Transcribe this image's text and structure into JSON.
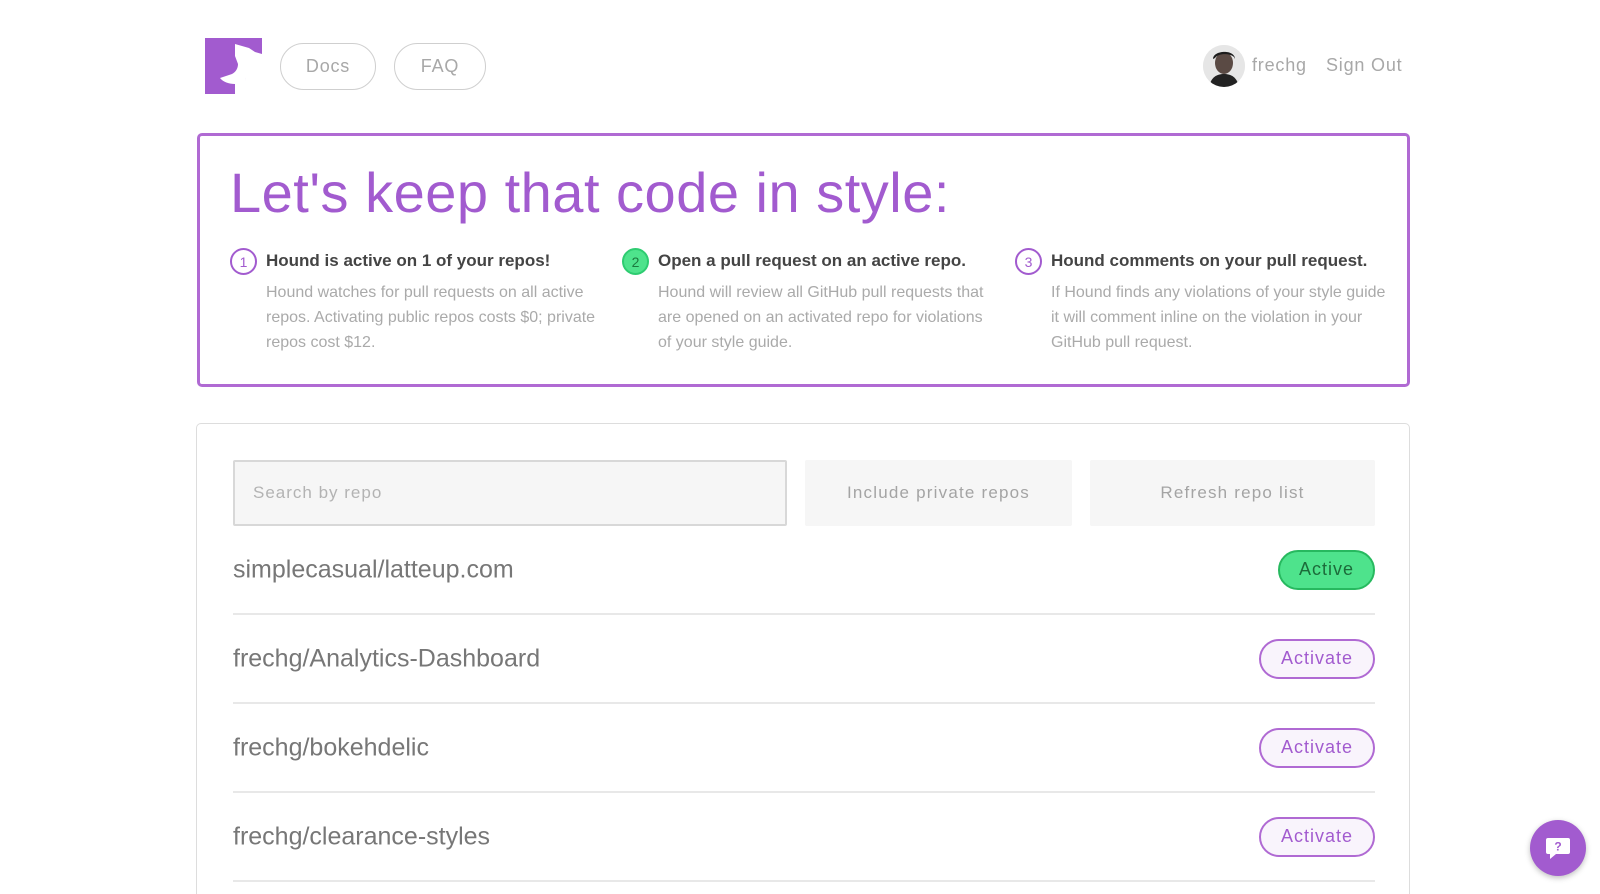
{
  "brand": {
    "accent": "#a25bcf",
    "success": "#4ee38c"
  },
  "header": {
    "logo_icon": "hound-dog-logo-icon",
    "nav": [
      {
        "label": "Docs"
      },
      {
        "label": "FAQ"
      }
    ],
    "user": {
      "name": "frechg",
      "avatar_icon": "user-avatar"
    },
    "signout_label": "Sign Out"
  },
  "hero": {
    "title": "Let's keep that code in style:",
    "steps": [
      {
        "number": "1",
        "title": "Hound is active on 1 of your repos!",
        "body": "Hound watches for pull requests on all active repos. Activating public repos costs $0; private repos cost $12."
      },
      {
        "number": "2",
        "title": "Open a pull request on an active repo.",
        "body": "Hound will review all GitHub pull requests that are opened on an activated repo for violations of your style guide."
      },
      {
        "number": "3",
        "title": "Hound comments on your pull request.",
        "body": "If Hound finds any violations of your style guide it will comment inline on the violation in your GitHub pull request."
      }
    ]
  },
  "repos": {
    "search": {
      "placeholder": "Search by repo",
      "value": ""
    },
    "private_button": "Include private repos",
    "refresh_button": "Refresh repo list",
    "items": [
      {
        "name": "simplecasual/latteup.com",
        "status": "Active"
      },
      {
        "name": "frechg/Analytics-Dashboard",
        "status": "Activate"
      },
      {
        "name": "frechg/bokehdelic",
        "status": "Activate"
      },
      {
        "name": "frechg/clearance-styles",
        "status": "Activate"
      }
    ]
  },
  "help": {
    "icon": "help-chat-icon",
    "glyph": "?"
  }
}
